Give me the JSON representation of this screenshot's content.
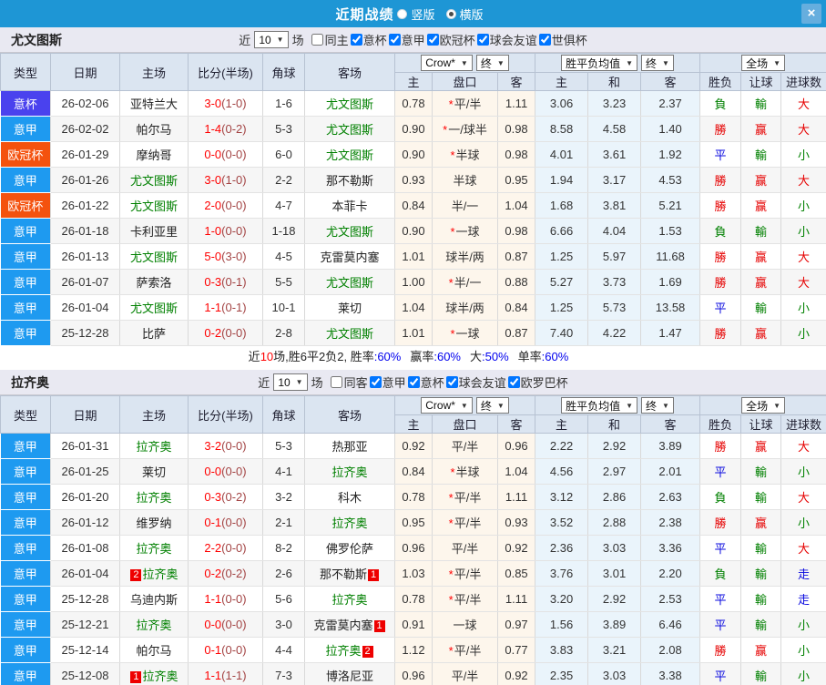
{
  "titlebar": {
    "title": "近期战绩",
    "radio_vertical": "竖版",
    "radio_horizontal": "横版",
    "close": "×"
  },
  "table_header": {
    "cols": [
      "类型",
      "日期",
      "主场",
      "比分(半场)",
      "角球",
      "客场"
    ],
    "sub": [
      "主",
      "盘口",
      "客",
      "主",
      "和",
      "客",
      "胜负",
      "让球",
      "进球数"
    ],
    "dd": {
      "company": "Crow*",
      "final1": "终",
      "avg": "胜平负均值",
      "final2": "终",
      "scope": "全场"
    }
  },
  "colors": {
    "titlebar_bg": "#1e96d5",
    "type_badges": {
      "意杯": "#4a42ee",
      "意甲": "#1e9af0",
      "欧冠杯": "#f4520e"
    },
    "focus_team": "#008000",
    "score_full": "#ff0000",
    "score_half": "#a34444",
    "odds_col_bg": "#fdf6ec",
    "avg_col_bg": "#eaf4fb",
    "badge_bg": "#ee0000",
    "result": {
      "勝": "#e60000",
      "平": "#0a0adf",
      "負": "#008000",
      "赢": "#e60000",
      "輸": "#008000",
      "大": "#e60000",
      "小": "#008000",
      "走": "#0a0adf"
    }
  },
  "sections": [
    {
      "team": "尤文图斯",
      "filter": {
        "near": "近",
        "count": "10",
        "games": "场",
        "same": "同主",
        "leagues": [
          "意杯",
          "意甲",
          "欧冠杯",
          "球会友谊",
          "世俱杯"
        ]
      },
      "rows": [
        {
          "type": "意杯",
          "date": "26-02-06",
          "home": {
            "name": "亚特兰大",
            "focus": false
          },
          "score": {
            "full": "3-0",
            "half": "(1-0)"
          },
          "corner": "1-6",
          "away": {
            "name": "尤文图斯",
            "focus": true
          },
          "odds": {
            "home": "0.78",
            "handicap": "平/半",
            "star": true,
            "away": "1.11"
          },
          "avg": {
            "home": "3.06",
            "draw": "3.23",
            "away": "2.37"
          },
          "results": {
            "result": "負",
            "handicap_result": "輸",
            "goals": "大"
          }
        },
        {
          "type": "意甲",
          "date": "26-02-02",
          "home": {
            "name": "帕尔马",
            "focus": false
          },
          "score": {
            "full": "1-4",
            "half": "(0-2)"
          },
          "corner": "5-3",
          "away": {
            "name": "尤文图斯",
            "focus": true
          },
          "odds": {
            "home": "0.90",
            "handicap": "一/球半",
            "star": true,
            "away": "0.98"
          },
          "avg": {
            "home": "8.58",
            "draw": "4.58",
            "away": "1.40"
          },
          "results": {
            "result": "勝",
            "handicap_result": "赢",
            "goals": "大"
          }
        },
        {
          "type": "欧冠杯",
          "date": "26-01-29",
          "home": {
            "name": "摩纳哥",
            "focus": false
          },
          "score": {
            "full": "0-0",
            "half": "(0-0)"
          },
          "corner": "6-0",
          "away": {
            "name": "尤文图斯",
            "focus": true
          },
          "odds": {
            "home": "0.90",
            "handicap": "半球",
            "star": true,
            "away": "0.98"
          },
          "avg": {
            "home": "4.01",
            "draw": "3.61",
            "away": "1.92"
          },
          "results": {
            "result": "平",
            "handicap_result": "輸",
            "goals": "小"
          }
        },
        {
          "type": "意甲",
          "date": "26-01-26",
          "home": {
            "name": "尤文图斯",
            "focus": true
          },
          "score": {
            "full": "3-0",
            "half": "(1-0)"
          },
          "corner": "2-2",
          "away": {
            "name": "那不勒斯",
            "focus": false
          },
          "odds": {
            "home": "0.93",
            "handicap": "半球",
            "star": false,
            "away": "0.95"
          },
          "avg": {
            "home": "1.94",
            "draw": "3.17",
            "away": "4.53"
          },
          "results": {
            "result": "勝",
            "handicap_result": "赢",
            "goals": "大"
          }
        },
        {
          "type": "欧冠杯",
          "date": "26-01-22",
          "home": {
            "name": "尤文图斯",
            "focus": true
          },
          "score": {
            "full": "2-0",
            "half": "(0-0)"
          },
          "corner": "4-7",
          "away": {
            "name": "本菲卡",
            "focus": false
          },
          "odds": {
            "home": "0.84",
            "handicap": "半/一",
            "star": false,
            "away": "1.04"
          },
          "avg": {
            "home": "1.68",
            "draw": "3.81",
            "away": "5.21"
          },
          "results": {
            "result": "勝",
            "handicap_result": "赢",
            "goals": "小"
          }
        },
        {
          "type": "意甲",
          "date": "26-01-18",
          "home": {
            "name": "卡利亚里",
            "focus": false
          },
          "score": {
            "full": "1-0",
            "half": "(0-0)"
          },
          "corner": "1-18",
          "away": {
            "name": "尤文图斯",
            "focus": true
          },
          "odds": {
            "home": "0.90",
            "handicap": "一球",
            "star": true,
            "away": "0.98"
          },
          "avg": {
            "home": "6.66",
            "draw": "4.04",
            "away": "1.53"
          },
          "results": {
            "result": "負",
            "handicap_result": "輸",
            "goals": "小"
          }
        },
        {
          "type": "意甲",
          "date": "26-01-13",
          "home": {
            "name": "尤文图斯",
            "focus": true
          },
          "score": {
            "full": "5-0",
            "half": "(3-0)"
          },
          "corner": "4-5",
          "away": {
            "name": "克雷莫内塞",
            "focus": false
          },
          "odds": {
            "home": "1.01",
            "handicap": "球半/两",
            "star": false,
            "away": "0.87"
          },
          "avg": {
            "home": "1.25",
            "draw": "5.97",
            "away": "11.68"
          },
          "results": {
            "result": "勝",
            "handicap_result": "赢",
            "goals": "大"
          }
        },
        {
          "type": "意甲",
          "date": "26-01-07",
          "home": {
            "name": "萨索洛",
            "focus": false
          },
          "score": {
            "full": "0-3",
            "half": "(0-1)"
          },
          "corner": "5-5",
          "away": {
            "name": "尤文图斯",
            "focus": true
          },
          "odds": {
            "home": "1.00",
            "handicap": "半/一",
            "star": true,
            "away": "0.88"
          },
          "avg": {
            "home": "5.27",
            "draw": "3.73",
            "away": "1.69"
          },
          "results": {
            "result": "勝",
            "handicap_result": "赢",
            "goals": "大"
          }
        },
        {
          "type": "意甲",
          "date": "26-01-04",
          "home": {
            "name": "尤文图斯",
            "focus": true
          },
          "score": {
            "full": "1-1",
            "half": "(0-1)"
          },
          "corner": "10-1",
          "away": {
            "name": "莱切",
            "focus": false
          },
          "odds": {
            "home": "1.04",
            "handicap": "球半/两",
            "star": false,
            "away": "0.84"
          },
          "avg": {
            "home": "1.25",
            "draw": "5.73",
            "away": "13.58"
          },
          "results": {
            "result": "平",
            "handicap_result": "輸",
            "goals": "小"
          }
        },
        {
          "type": "意甲",
          "date": "25-12-28",
          "home": {
            "name": "比萨",
            "focus": false
          },
          "score": {
            "full": "0-2",
            "half": "(0-0)"
          },
          "corner": "2-8",
          "away": {
            "name": "尤文图斯",
            "focus": true
          },
          "odds": {
            "home": "1.01",
            "handicap": "一球",
            "star": true,
            "away": "0.87"
          },
          "avg": {
            "home": "7.40",
            "draw": "4.22",
            "away": "1.47"
          },
          "results": {
            "result": "勝",
            "handicap_result": "赢",
            "goals": "小"
          }
        }
      ],
      "summary": {
        "prefix": "近",
        "count": "10",
        "middle": "场,胜6平2负2, ",
        "stats": [
          {
            "label": "胜率",
            "value": ":60%"
          },
          {
            "label": "赢率",
            "value": ":60%"
          },
          {
            "label": "大",
            "value": ":50%"
          },
          {
            "label": "单率",
            "value": ":60%"
          }
        ]
      }
    },
    {
      "team": "拉齐奥",
      "filter": {
        "near": "近",
        "count": "10",
        "games": "场",
        "same": "同客",
        "leagues": [
          "意甲",
          "意杯",
          "球会友谊",
          "欧罗巴杯"
        ]
      },
      "rows": [
        {
          "type": "意甲",
          "date": "26-01-31",
          "home": {
            "name": "拉齐奥",
            "focus": true
          },
          "score": {
            "full": "3-2",
            "half": "(0-0)"
          },
          "corner": "5-3",
          "away": {
            "name": "热那亚",
            "focus": false
          },
          "odds": {
            "home": "0.92",
            "handicap": "平/半",
            "star": false,
            "away": "0.96"
          },
          "avg": {
            "home": "2.22",
            "draw": "2.92",
            "away": "3.89"
          },
          "results": {
            "result": "勝",
            "handicap_result": "赢",
            "goals": "大"
          }
        },
        {
          "type": "意甲",
          "date": "26-01-25",
          "home": {
            "name": "莱切",
            "focus": false
          },
          "score": {
            "full": "0-0",
            "half": "(0-0)"
          },
          "corner": "4-1",
          "away": {
            "name": "拉齐奥",
            "focus": true
          },
          "odds": {
            "home": "0.84",
            "handicap": "半球",
            "star": true,
            "away": "1.04"
          },
          "avg": {
            "home": "4.56",
            "draw": "2.97",
            "away": "2.01"
          },
          "results": {
            "result": "平",
            "handicap_result": "輸",
            "goals": "小"
          }
        },
        {
          "type": "意甲",
          "date": "26-01-20",
          "home": {
            "name": "拉齐奥",
            "focus": true
          },
          "score": {
            "full": "0-3",
            "half": "(0-2)"
          },
          "corner": "3-2",
          "away": {
            "name": "科木",
            "focus": false
          },
          "odds": {
            "home": "0.78",
            "handicap": "平/半",
            "star": true,
            "away": "1.11"
          },
          "avg": {
            "home": "3.12",
            "draw": "2.86",
            "away": "2.63"
          },
          "results": {
            "result": "負",
            "handicap_result": "輸",
            "goals": "大"
          }
        },
        {
          "type": "意甲",
          "date": "26-01-12",
          "home": {
            "name": "维罗纳",
            "focus": false
          },
          "score": {
            "full": "0-1",
            "half": "(0-0)"
          },
          "corner": "2-1",
          "away": {
            "name": "拉齐奥",
            "focus": true
          },
          "odds": {
            "home": "0.95",
            "handicap": "平/半",
            "star": true,
            "away": "0.93"
          },
          "avg": {
            "home": "3.52",
            "draw": "2.88",
            "away": "2.38"
          },
          "results": {
            "result": "勝",
            "handicap_result": "赢",
            "goals": "小"
          }
        },
        {
          "type": "意甲",
          "date": "26-01-08",
          "home": {
            "name": "拉齐奥",
            "focus": true
          },
          "score": {
            "full": "2-2",
            "half": "(0-0)"
          },
          "corner": "8-2",
          "away": {
            "name": "佛罗伦萨",
            "focus": false
          },
          "odds": {
            "home": "0.96",
            "handicap": "平/半",
            "star": false,
            "away": "0.92"
          },
          "avg": {
            "home": "2.36",
            "draw": "3.03",
            "away": "3.36"
          },
          "results": {
            "result": "平",
            "handicap_result": "輸",
            "goals": "大"
          }
        },
        {
          "type": "意甲",
          "date": "26-01-04",
          "home": {
            "name": "拉齐奥",
            "focus": true,
            "badge_before": "2"
          },
          "score": {
            "full": "0-2",
            "half": "(0-2)"
          },
          "corner": "2-6",
          "away": {
            "name": "那不勒斯",
            "focus": false,
            "badge_after": "1"
          },
          "odds": {
            "home": "1.03",
            "handicap": "平/半",
            "star": true,
            "away": "0.85"
          },
          "avg": {
            "home": "3.76",
            "draw": "3.01",
            "away": "2.20"
          },
          "results": {
            "result": "負",
            "handicap_result": "輸",
            "goals": "走"
          }
        },
        {
          "type": "意甲",
          "date": "25-12-28",
          "home": {
            "name": "乌迪内斯",
            "focus": false
          },
          "score": {
            "full": "1-1",
            "half": "(0-0)"
          },
          "corner": "5-6",
          "away": {
            "name": "拉齐奥",
            "focus": true
          },
          "odds": {
            "home": "0.78",
            "handicap": "平/半",
            "star": true,
            "away": "1.11"
          },
          "avg": {
            "home": "3.20",
            "draw": "2.92",
            "away": "2.53"
          },
          "results": {
            "result": "平",
            "handicap_result": "輸",
            "goals": "走"
          }
        },
        {
          "type": "意甲",
          "date": "25-12-21",
          "home": {
            "name": "拉齐奥",
            "focus": true
          },
          "score": {
            "full": "0-0",
            "half": "(0-0)"
          },
          "corner": "3-0",
          "away": {
            "name": "克雷莫内塞",
            "focus": false,
            "badge_after": "1"
          },
          "odds": {
            "home": "0.91",
            "handicap": "一球",
            "star": false,
            "away": "0.97"
          },
          "avg": {
            "home": "1.56",
            "draw": "3.89",
            "away": "6.46"
          },
          "results": {
            "result": "平",
            "handicap_result": "輸",
            "goals": "小"
          }
        },
        {
          "type": "意甲",
          "date": "25-12-14",
          "home": {
            "name": "帕尔马",
            "focus": false
          },
          "score": {
            "full": "0-1",
            "half": "(0-0)"
          },
          "corner": "4-4",
          "away": {
            "name": "拉齐奥",
            "focus": true,
            "badge_after": "2"
          },
          "odds": {
            "home": "1.12",
            "handicap": "平/半",
            "star": true,
            "away": "0.77"
          },
          "avg": {
            "home": "3.83",
            "draw": "3.21",
            "away": "2.08"
          },
          "results": {
            "result": "勝",
            "handicap_result": "赢",
            "goals": "小"
          }
        },
        {
          "type": "意甲",
          "date": "25-12-08",
          "home": {
            "name": "拉齐奥",
            "focus": true,
            "badge_before": "1"
          },
          "score": {
            "full": "1-1",
            "half": "(1-1)"
          },
          "corner": "7-3",
          "away": {
            "name": "博洛尼亚",
            "focus": false
          },
          "odds": {
            "home": "0.96",
            "handicap": "平/半",
            "star": false,
            "away": "0.92"
          },
          "avg": {
            "home": "2.35",
            "draw": "3.03",
            "away": "3.38"
          },
          "results": {
            "result": "平",
            "handicap_result": "輸",
            "goals": "小"
          }
        }
      ],
      "summary": null
    }
  ]
}
